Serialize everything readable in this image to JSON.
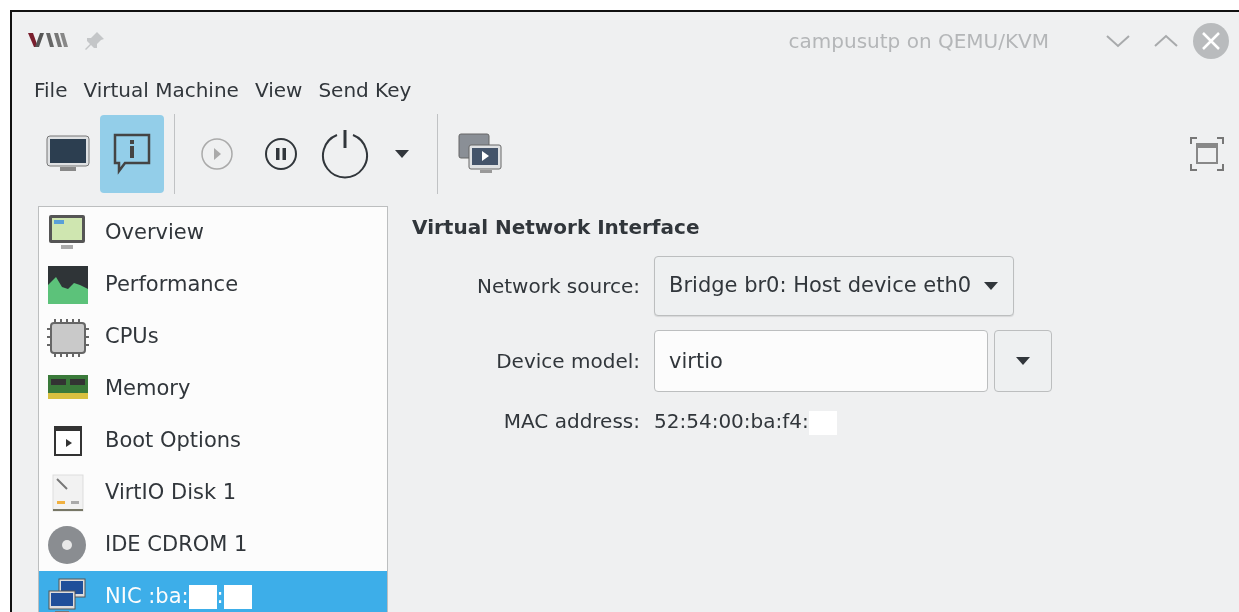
{
  "window": {
    "title": "campusutp on QEMU/KVM"
  },
  "menu": [
    {
      "label": "File"
    },
    {
      "label": "Virtual Machine"
    },
    {
      "label": "View"
    },
    {
      "label": "Send Key"
    }
  ],
  "toolbar": [
    {
      "kind": "console",
      "selected": false
    },
    {
      "kind": "details",
      "selected": true
    },
    {
      "kind": "separator"
    },
    {
      "kind": "run",
      "disabled": true
    },
    {
      "kind": "pause",
      "disabled": false
    },
    {
      "kind": "shutdown",
      "disabled": false
    },
    {
      "kind": "caret",
      "disabled": false
    },
    {
      "kind": "separator"
    },
    {
      "kind": "snapshots",
      "selected": false
    }
  ],
  "sidebar": {
    "items": [
      {
        "kind": "overview",
        "selected": false,
        "segments": [
          {
            "kind": "text",
            "text": "Overview"
          }
        ]
      },
      {
        "kind": "performance",
        "selected": false,
        "segments": [
          {
            "kind": "text",
            "text": "Performance"
          }
        ]
      },
      {
        "kind": "cpu",
        "selected": false,
        "segments": [
          {
            "kind": "text",
            "text": "CPUs"
          }
        ]
      },
      {
        "kind": "memory",
        "selected": false,
        "segments": [
          {
            "kind": "text",
            "text": "Memory"
          }
        ]
      },
      {
        "kind": "boot",
        "selected": false,
        "segments": [
          {
            "kind": "text",
            "text": "Boot Options"
          }
        ]
      },
      {
        "kind": "disk",
        "selected": false,
        "segments": [
          {
            "kind": "text",
            "text": "VirtIO Disk 1"
          }
        ]
      },
      {
        "kind": "cdrom",
        "selected": false,
        "segments": [
          {
            "kind": "text",
            "text": "IDE CDROM 1"
          }
        ]
      },
      {
        "kind": "nic",
        "selected": true,
        "segments": [
          {
            "kind": "text",
            "text": "NIC :ba:"
          },
          {
            "kind": "redacted"
          },
          {
            "kind": "text",
            "text": ":"
          },
          {
            "kind": "redacted"
          }
        ]
      }
    ]
  },
  "details": {
    "heading": "Virtual Network Interface",
    "fields": [
      {
        "kind": "combo",
        "label": "Network source:",
        "value": "Bridge br0: Host device eth0"
      },
      {
        "kind": "entry",
        "label": "Device model:",
        "value": "virtio"
      },
      {
        "kind": "text",
        "label": "MAC address:",
        "segments": [
          {
            "kind": "text",
            "text": "52:54:00:ba:f4:"
          },
          {
            "kind": "redacted"
          }
        ]
      }
    ]
  }
}
